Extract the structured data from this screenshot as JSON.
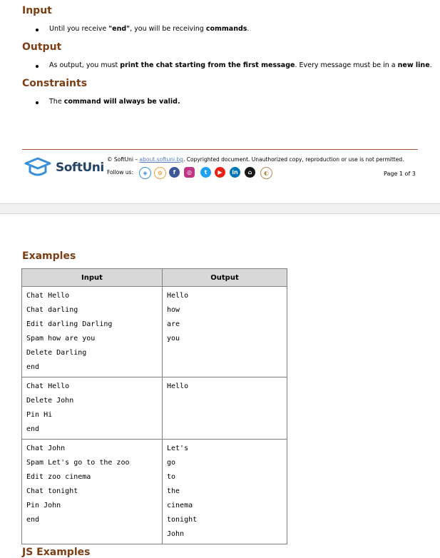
{
  "sections": {
    "input_heading": "Input",
    "input_bullet_pre": "Until you receive ",
    "input_bullet_bold1": "\"end\"",
    "input_bullet_mid": ", you will be receiving ",
    "input_bullet_bold2": "commands",
    "input_bullet_end": ".",
    "output_heading": "Output",
    "output_bullet_pre": "As output, you must ",
    "output_bullet_bold1": "print the chat starting from the first message",
    "output_bullet_mid": ". Every message must be in a ",
    "output_bullet_bold2": "new line",
    "output_bullet_end": ".",
    "constraints_heading": "Constraints",
    "constraints_bullet_pre": "The ",
    "constraints_bullet_bold": "command will always be valid."
  },
  "footer": {
    "brand": "SoftUni",
    "copyright_pre": "© SoftUni – ",
    "copyright_link": "about.softuni.bg",
    "copyright_post": ". Copyrighted document. Unauthorized copy, reproduction or use is not permitted.",
    "follow_label": "Follow us:",
    "page_number": "Page 1 of 3",
    "social_icons": [
      "softuni-icon",
      "softuni-foundation-icon",
      "facebook-icon",
      "instagram-icon",
      "twitter-icon",
      "youtube-icon",
      "linkedin-icon",
      "github-icon",
      "softuni-creative-icon"
    ]
  },
  "examples": {
    "heading": "Examples",
    "col_input": "Input",
    "col_output": "Output",
    "rows": [
      {
        "input": [
          "Chat Hello",
          "Chat darling",
          "Edit darling Darling",
          "Spam how are you",
          "Delete Darling",
          "end"
        ],
        "output": [
          "Hello",
          "how",
          "are",
          "you"
        ]
      },
      {
        "input": [
          "Chat Hello",
          "Delete John",
          "Pin Hi",
          "end"
        ],
        "output": [
          "Hello"
        ]
      },
      {
        "input": [
          "Chat John",
          "Spam Let's go to the zoo",
          "Edit zoo cinema",
          "Chat tonight",
          "Pin John",
          "end"
        ],
        "output": [
          "Let's",
          "go",
          "to",
          "the",
          "cinema",
          "tonight",
          "John"
        ]
      }
    ],
    "next_heading": "JS Examples"
  }
}
